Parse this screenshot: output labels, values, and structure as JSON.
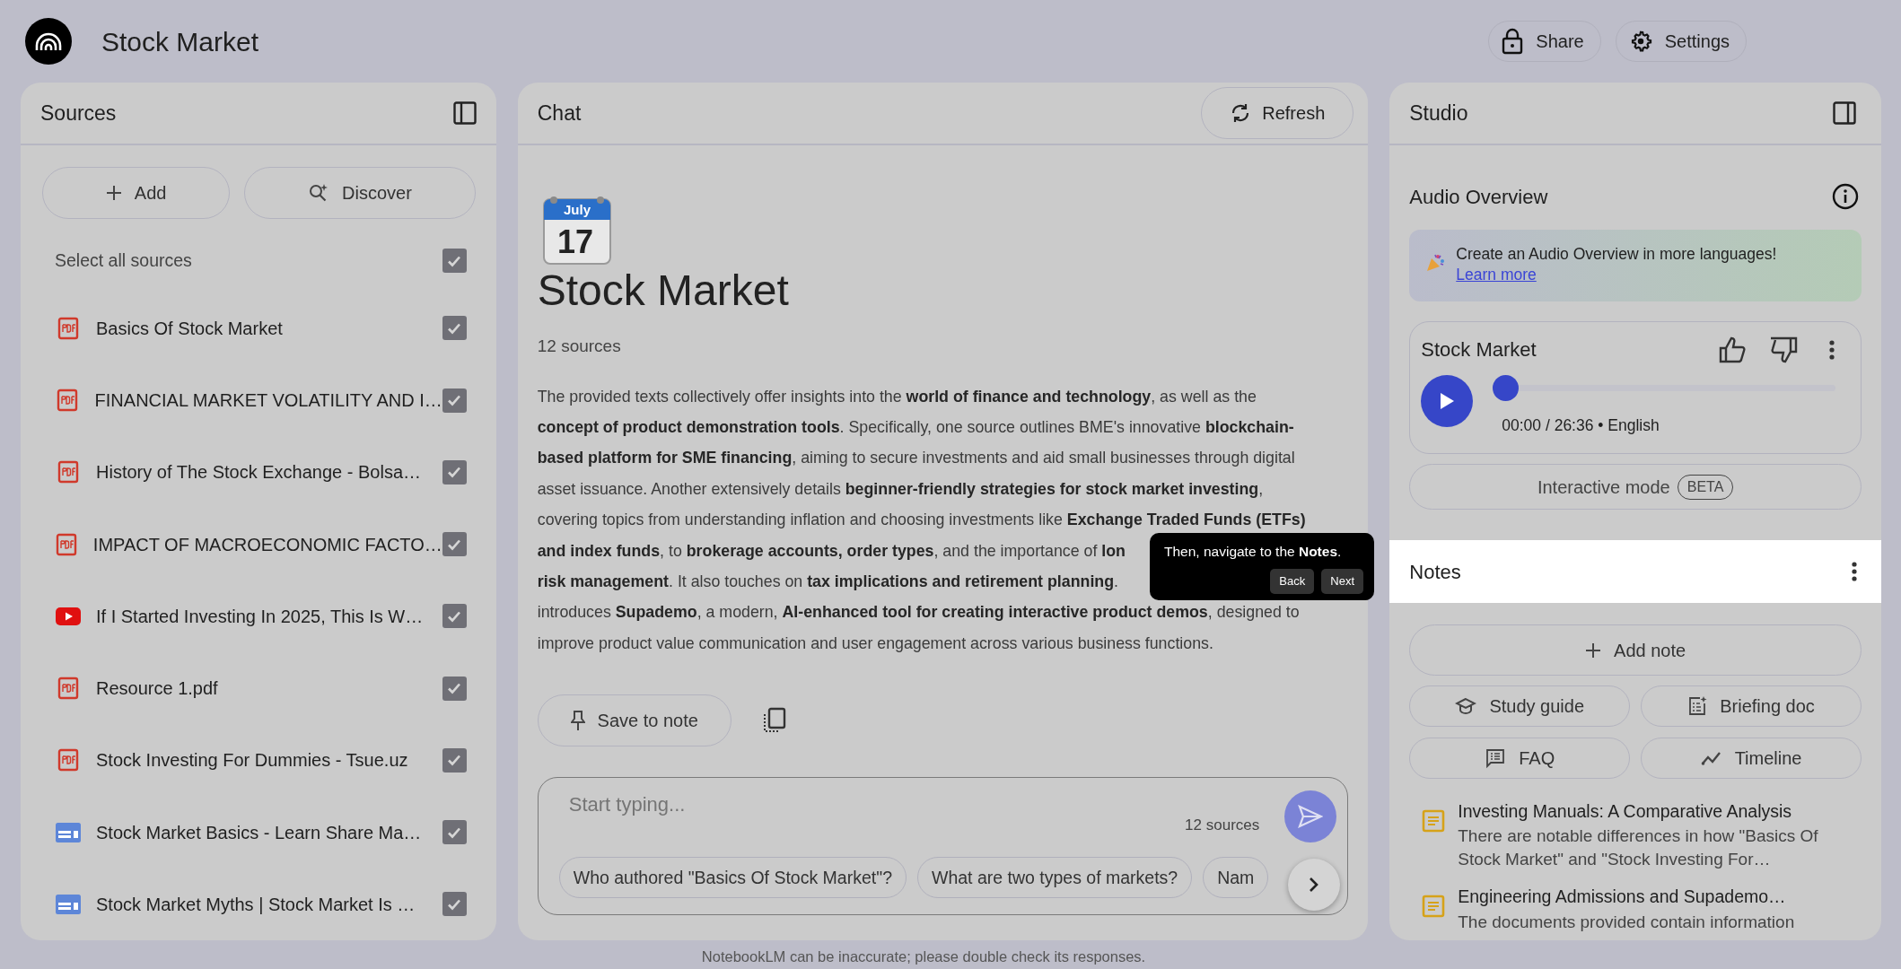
{
  "app": {
    "title": "Stock Market"
  },
  "header_buttons": [
    {
      "label": "Share",
      "kind": "share"
    },
    {
      "label": "Settings",
      "kind": "settings"
    }
  ],
  "sources": {
    "title": "Sources",
    "actions": [
      {
        "label": "Add",
        "kind": "add"
      },
      {
        "label": "Discover",
        "kind": "discover"
      }
    ],
    "select_all": {
      "label": "Select all sources",
      "checked": true
    },
    "items": [
      {
        "title": "Basics Of Stock Market",
        "kind": "pdf",
        "checked": true
      },
      {
        "title": "FINANCIAL MARKET VOLATILITY AND I…",
        "kind": "pdf",
        "checked": true
      },
      {
        "title": "History of The Stock Exchange - Bolsa…",
        "kind": "pdf",
        "checked": true
      },
      {
        "title": "IMPACT OF MACROECONOMIC FACTO…",
        "kind": "pdf",
        "checked": true
      },
      {
        "title": "If I Started Investing In 2025, This Is W…",
        "kind": "video",
        "checked": true
      },
      {
        "title": "Resource 1.pdf",
        "kind": "pdf",
        "checked": true
      },
      {
        "title": "Stock Investing For Dummies - Tsue.uz",
        "kind": "pdf",
        "checked": true
      },
      {
        "title": "Stock Market Basics - Learn Share Ma…",
        "kind": "web",
        "checked": true
      },
      {
        "title": "Stock Market Myths | Stock Market Is …",
        "kind": "web",
        "checked": true
      }
    ]
  },
  "chat": {
    "title": "Chat",
    "refresh": "Refresh",
    "calendar": {
      "month": "July",
      "day": "17"
    },
    "notebook_title": "Stock Market",
    "source_count": "12 sources",
    "summary_lines": [
      "The provided texts collectively offer insights into the **world of finance and technology**, as well as the",
      "**concept of product demonstration tools**. Specifically, one source outlines BME's innovative **blockchain-**",
      "**based platform for SME financing**, aiming to secure investments and aid small businesses through digital",
      "asset issuance. Another extensively details **beginner-friendly strategies for stock market investing**,",
      "covering topics from understanding inflation and choosing investments like **Exchange Traded Funds (ETFs)**",
      "**and index funds**, to **brokerage accounts, order types**, and the importance of **lon**",
      "**risk management**. It also touches on **tax implications and retirement planning**.",
      "introduces **Supademo**, a modern, **AI-enhanced tool for creating interactive product demos**, designed to",
      "improve product value communication and user engagement across various business functions."
    ],
    "save_button": "Save to note",
    "input": {
      "placeholder": "Start typing...",
      "source_count": "12 sources"
    },
    "suggestions": [
      "Who authored \"Basics Of Stock Market\"?",
      "What are two types of markets?",
      "Nam"
    ]
  },
  "studio": {
    "title": "Studio",
    "audio_overview": {
      "title": "Audio Overview",
      "banner_text": "Create an Audio Overview in more languages!",
      "banner_link": "Learn more",
      "card": {
        "title": "Stock Market",
        "time": "00:00 / 26:36 • English",
        "level": 0
      },
      "interactive": {
        "label": "Interactive mode",
        "badge": "BETA"
      }
    },
    "notes": {
      "title": "Notes",
      "add": "Add note",
      "tools": [
        {
          "label": "Study guide",
          "kind": "study"
        },
        {
          "label": "Briefing doc",
          "kind": "briefing"
        },
        {
          "label": "FAQ",
          "kind": "faq"
        },
        {
          "label": "Timeline",
          "kind": "timeline"
        }
      ],
      "items": [
        {
          "title": "Investing Manuals: A Comparative Analysis",
          "body": "There are notable differences in how \"Basics Of Stock Market\" and \"Stock Investing For…"
        },
        {
          "title": "Engineering Admissions and Supademo…",
          "body": "The documents provided contain information"
        }
      ]
    }
  },
  "tooltip": {
    "text": "Then, navigate to the **Notes**.",
    "buttons": [
      "Back",
      "Next"
    ]
  },
  "footer": "NotebookLM can be inaccurate; please double check its responses."
}
